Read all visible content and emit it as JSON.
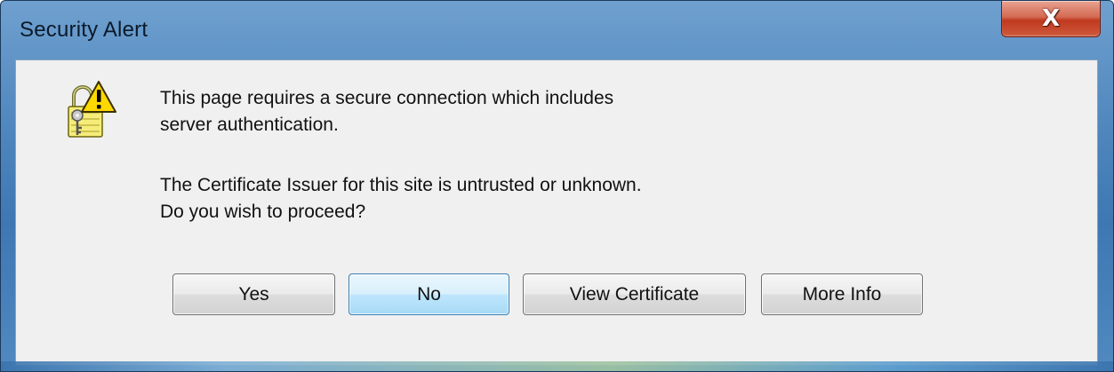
{
  "window": {
    "title": "Security Alert",
    "close_glyph": "X"
  },
  "icons": {
    "warning": "lock-warning-icon",
    "close": "close-icon"
  },
  "message": {
    "line1": "This page requires a secure connection which includes",
    "line2": "server authentication.",
    "line3": "The Certificate Issuer for this site is untrusted or unknown.",
    "line4": "Do you wish to proceed?"
  },
  "buttons": {
    "yes": "Yes",
    "no": "No",
    "view_certificate": "View Certificate",
    "more_info": "More Info",
    "default": "no"
  },
  "colors": {
    "titlebar": "#4f86bd",
    "close_button": "#c0391f",
    "client_background": "#f0f0f0",
    "default_button": "#bee6fd"
  }
}
